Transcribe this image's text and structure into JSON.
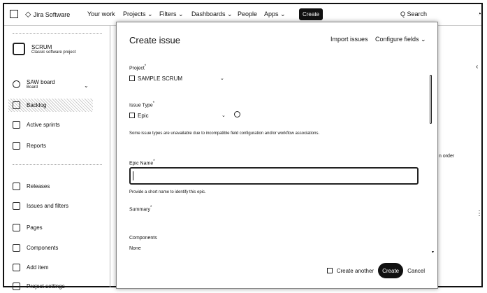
{
  "topnav": {
    "logo_text": "Jira Software",
    "items": [
      "Your work",
      "Projects ⌄",
      "Filters ⌄",
      "Dashboards ⌄",
      "People",
      "Apps ⌄"
    ],
    "create_label": "Create",
    "search_placeholder": "Q Search"
  },
  "sidebar": {
    "project_name": "SCRUM",
    "project_type": "Classic software project",
    "board_name": "SAW board",
    "board_sub": "Board",
    "items": [
      "Backlog",
      "Active sprints",
      "Reports",
      "Releases",
      "Issues and filters",
      "Pages",
      "Components",
      "Add item",
      "Project settings"
    ]
  },
  "background": {
    "text_fragment": "n order"
  },
  "modal": {
    "title": "Create issue",
    "import_label": "Import issues",
    "configure_label": "Configure fields ⌄",
    "project_label": "Project",
    "project_value": "SAMPLE SCRUM",
    "issue_type_label": "Issue Type",
    "issue_type_value": "Epic",
    "issue_type_note": "Some issue types are unavailable due to incompatible field configuration and/or workflow associations.",
    "epic_name_label": "Epic Name",
    "epic_name_value": "",
    "epic_name_help": "Provide a short name to identify this epic.",
    "summary_label": "Summary",
    "components_label": "Components",
    "components_value": "None",
    "create_another_label": "Create another",
    "create_label": "Create",
    "cancel_label": "Cancel"
  }
}
